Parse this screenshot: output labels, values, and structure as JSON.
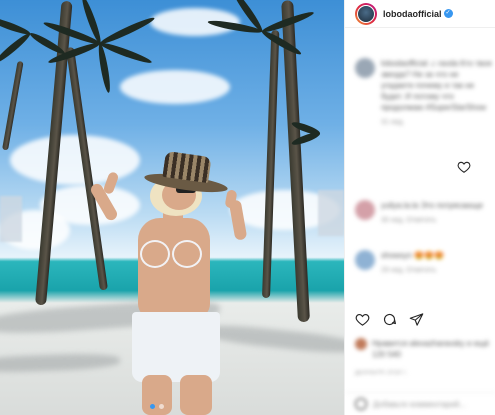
{
  "post": {
    "username": "lobodaofficial",
    "verified_badge": "✓",
    "caption": "lobodaofficial  ♫ ravda Кто твоя звезда? Ни за что не угадаете почему и так не будет. И потому что продолжаю #SuperStarShow",
    "caption_time": "31 нед.",
    "comments": [
      {
        "user": "yuliya.la.la",
        "text": "yuliya.la.la Это потрясающе",
        "meta": "30 нед.   Ответить"
      },
      {
        "user": "showsyn",
        "text": "showsyn 😍😍😍",
        "meta": "29 нед.   Ответить"
      }
    ],
    "likes": {
      "text": "Нравится alexazharavsky и ещё 120 540"
    },
    "date": "ДЕКАБРЯ 2018 Г.",
    "add_comment_placeholder": "Добавьте комментарий..."
  },
  "icons": {
    "like": "heart-icon",
    "comment": "comment-icon",
    "share": "share-icon",
    "comment_like": "heart-outline-icon",
    "emoji": "emoji-icon"
  },
  "colors": {
    "accent": "#3897f0",
    "story_ring_start": "#f09433",
    "story_ring_end": "#bc1888"
  }
}
